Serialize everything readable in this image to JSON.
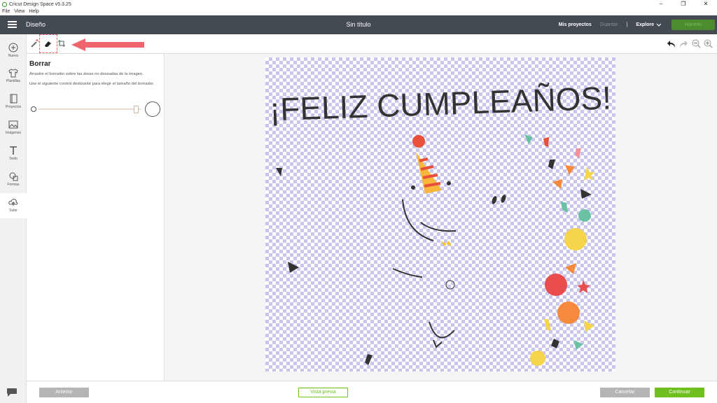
{
  "window": {
    "title": "Cricut Design Space  v5.3.25",
    "controls": [
      "–",
      "❐",
      "✕"
    ]
  },
  "menu": [
    "File",
    "View",
    "Help"
  ],
  "header": {
    "section": "Diseño",
    "title": "Sin título",
    "my_projects": "Mis proyectos",
    "save": "Guardar",
    "separator": "|",
    "explore": "Explore",
    "make_it": "Hacerlo"
  },
  "sidebar": {
    "items": [
      {
        "label": "Nuevo",
        "icon": "plus-circle-icon"
      },
      {
        "label": "Plantillas",
        "icon": "tshirt-icon"
      },
      {
        "label": "Proyectos",
        "icon": "book-icon"
      },
      {
        "label": "Imágenes",
        "icon": "image-icon"
      },
      {
        "label": "Texto",
        "icon": "text-icon"
      },
      {
        "label": "Formas",
        "icon": "shapes-icon"
      },
      {
        "label": "Subir",
        "icon": "upload-cloud-icon"
      }
    ]
  },
  "panel": {
    "title": "Borrar",
    "instruction1": "Arrastre el borrador sobre las áreas no deseadas de la imagen.",
    "instruction2": "Use el siguiente control deslizante para elegir el tamaño del borrador.",
    "slider_level": 0.96
  },
  "canvas": {
    "headline": "¡FELIZ CUMPLEAÑOS!"
  },
  "colors": {
    "header_bg": "#434a52",
    "accent_green": "#6fbf1e",
    "arrow_red": "#f0646e",
    "checker": "#c9c6ee"
  },
  "footer": {
    "previous": "Anterior",
    "preview": "Vista previa",
    "cancel": "Cancelar",
    "continue": "Continuar"
  }
}
